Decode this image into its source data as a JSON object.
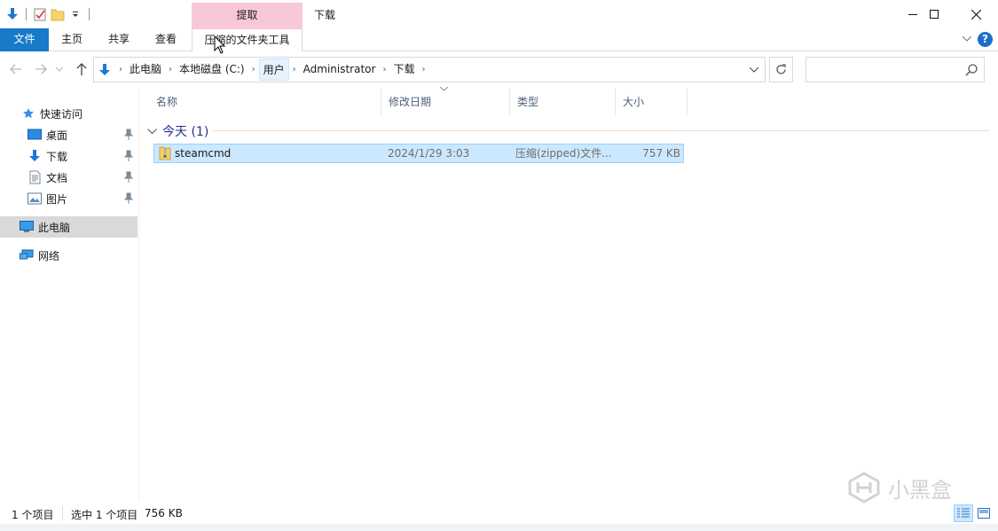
{
  "quick_access_toolbar": {
    "icons": [
      "download-icon",
      "properties-icon",
      "new-folder-icon",
      "customize-dropdown-icon"
    ]
  },
  "context_tab_header": "提取",
  "window_title": "下载",
  "window_controls": [
    "minimize",
    "maximize",
    "close"
  ],
  "ribbon": {
    "tabs": [
      "文件",
      "主页",
      "共享",
      "查看",
      "压缩的文件夹工具"
    ],
    "help_label": "?"
  },
  "address_bar": {
    "crumbs": [
      "此电脑",
      "本地磁盘 (C:)",
      "用户",
      "Administrator",
      "下载"
    ],
    "search_placeholder": ""
  },
  "nav_pane": {
    "quick_access": "快速访问",
    "pinned": [
      {
        "label": "桌面",
        "icon": "desktop-icon"
      },
      {
        "label": "下载",
        "icon": "download-icon"
      },
      {
        "label": "文档",
        "icon": "document-icon"
      },
      {
        "label": "图片",
        "icon": "pictures-icon"
      }
    ],
    "this_pc": "此电脑",
    "network": "网络"
  },
  "columns": [
    "名称",
    "修改日期",
    "类型",
    "大小"
  ],
  "group": {
    "label": "今天 (1)"
  },
  "files": [
    {
      "name": "steamcmd",
      "modified": "2024/1/29 3:03",
      "type": "压缩(zipped)文件...",
      "size": "757 KB"
    }
  ],
  "status": {
    "items": "1 个项目",
    "selected": "选中 1 个项目",
    "selected_size": "756 KB"
  },
  "watermark": "小黑盒",
  "colors": {
    "file_tab": "#1979ca",
    "context_header": "#f8c8d8",
    "selection_bg": "#cce8ff",
    "selection_border": "#99d1ff",
    "group_text": "#1e3287"
  }
}
